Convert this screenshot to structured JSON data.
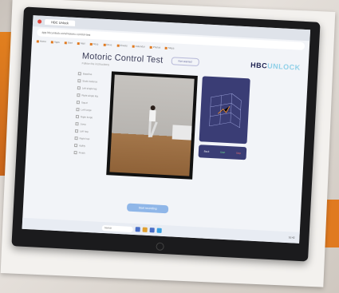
{
  "browser": {
    "tab_title": "HBC Unlock",
    "url": "app.hbcunlock.com/motoric-control-test",
    "bookmarks": [
      "Home",
      "Apps",
      "Start",
      "Mail",
      "Docs",
      "Drive",
      "Sheets",
      "Calendar",
      "Photos",
      "Maps"
    ]
  },
  "app": {
    "title": "Motoric Control Test",
    "subtitle": "Follow the instructions",
    "status": "Not started",
    "logo_main": "HBC",
    "logo_accent": "UNLOCK",
    "side_items": [
      "Baseline",
      "Static balance",
      "Left single leg",
      "Right single leg",
      "Squat",
      "Left lunge",
      "Right lunge",
      "Jump",
      "Left hop",
      "Right hop",
      "Agility",
      "Finish"
    ],
    "buttons": [
      "Back",
      "Start",
      "Stop"
    ],
    "start_label": "Start recording"
  },
  "taskbar": {
    "search_placeholder": "Search",
    "time": "10:42"
  },
  "colors": {
    "accent": "#3a3d75",
    "logo_accent": "#8fd0e8",
    "start": "#8fb6e8"
  }
}
